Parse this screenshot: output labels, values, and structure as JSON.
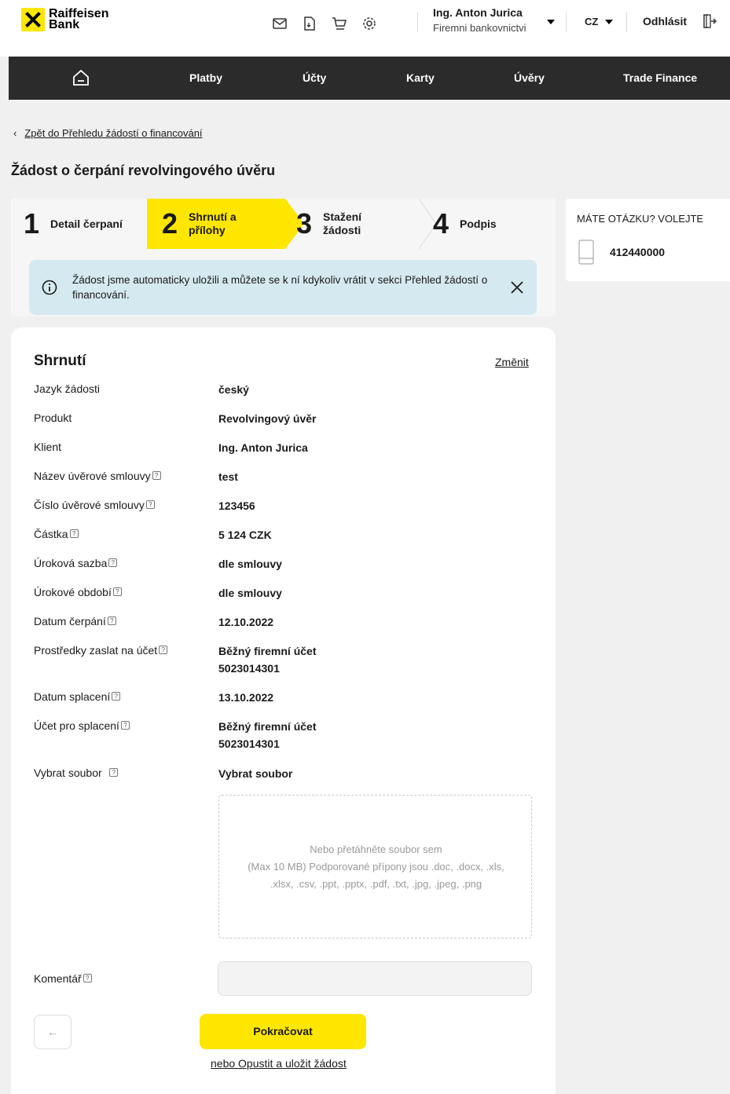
{
  "header": {
    "logo_text": "Raiffeisen\nBank",
    "icons": [
      "mail-icon",
      "document-icon",
      "cart-icon",
      "gear-icon"
    ],
    "user_name": "Ing. Anton Jurica",
    "user_role": "Firemni bankovnictvi",
    "language": "CZ",
    "logout_label": "Odhlásit"
  },
  "nav": {
    "items": [
      "Platby",
      "Účty",
      "Karty",
      "Úvěry",
      "Trade Finance"
    ]
  },
  "breadcrumb": {
    "back_label": "Zpět do Přehledu žádostí o financování"
  },
  "page_title": "Žádost o čerpání revolvingového úvěru",
  "stepper": {
    "steps": [
      {
        "num": "1",
        "label": "Detail čerpaní"
      },
      {
        "num": "2",
        "label": "Shrnutí a\npřílohy"
      },
      {
        "num": "3",
        "label": "Stažení\nžádosti"
      },
      {
        "num": "4",
        "label": "Podpis"
      }
    ],
    "active_color": "#fee600"
  },
  "side_help": {
    "title": "MÁTE OTÁZKU? VOLEJTE",
    "phone": "412440000"
  },
  "banner": {
    "text": "Žádost jsme automaticky uložili a můžete se k ní kdykoliv vrátit v sekci  Přehled žádostí o financování."
  },
  "summary": {
    "title": "Shrnutí",
    "change_label": "Změnit",
    "rows": [
      {
        "label": "Jazyk žádosti",
        "value": "český",
        "help": ""
      },
      {
        "label": "Produkt",
        "value": "Revolvingový úvěr",
        "help": ""
      },
      {
        "label": "Klient",
        "value": "Ing. Anton Jurica",
        "help": ""
      },
      {
        "label": "Název úvěrové smlouvy",
        "value": "test",
        "help": "?"
      },
      {
        "label": "Číslo úvěrové smlouvy",
        "value": "123456",
        "help": "?"
      },
      {
        "label": "Částka",
        "value": "5 124 CZK",
        "help": "?"
      },
      {
        "label": "Úroková sazba",
        "value": "dle smlouvy",
        "help": "?"
      },
      {
        "label": "Úrokové období",
        "value": "dle smlouvy",
        "help": "?"
      },
      {
        "label": "Datum čerpání",
        "value": "12.10.2022",
        "help": "?"
      },
      {
        "label": "Prostředky zaslat na účet",
        "value": "Běžný firemní účet",
        "value2": "5023014301",
        "help": "?"
      },
      {
        "label": "Datum splacení",
        "value": "13.10.2022",
        "help": "?"
      },
      {
        "label": "Účet pro splacení",
        "value": "Běžný firemní účet",
        "value2": "5023014301",
        "help": "?"
      },
      {
        "label": "Vybrat soubor",
        "value": "Vybrat soubor",
        "help": "?"
      }
    ],
    "dropzone_line1": "Nebo přetáhněte soubor sem",
    "dropzone_line2": "(Max 10 MB) Podporované přípony jsou .doc, .docx, .xls,",
    "dropzone_line3": ".xlsx, .csv, .ppt, .pptx, .pdf, .txt, .jpg, .jpeg, .png",
    "comment_label": "Komentář",
    "comment_help": "?",
    "comment_value": "",
    "back_arrow": "←",
    "continue_label": "Pokračovat",
    "leave_label": "nebo Opustit a uložit žádost"
  }
}
